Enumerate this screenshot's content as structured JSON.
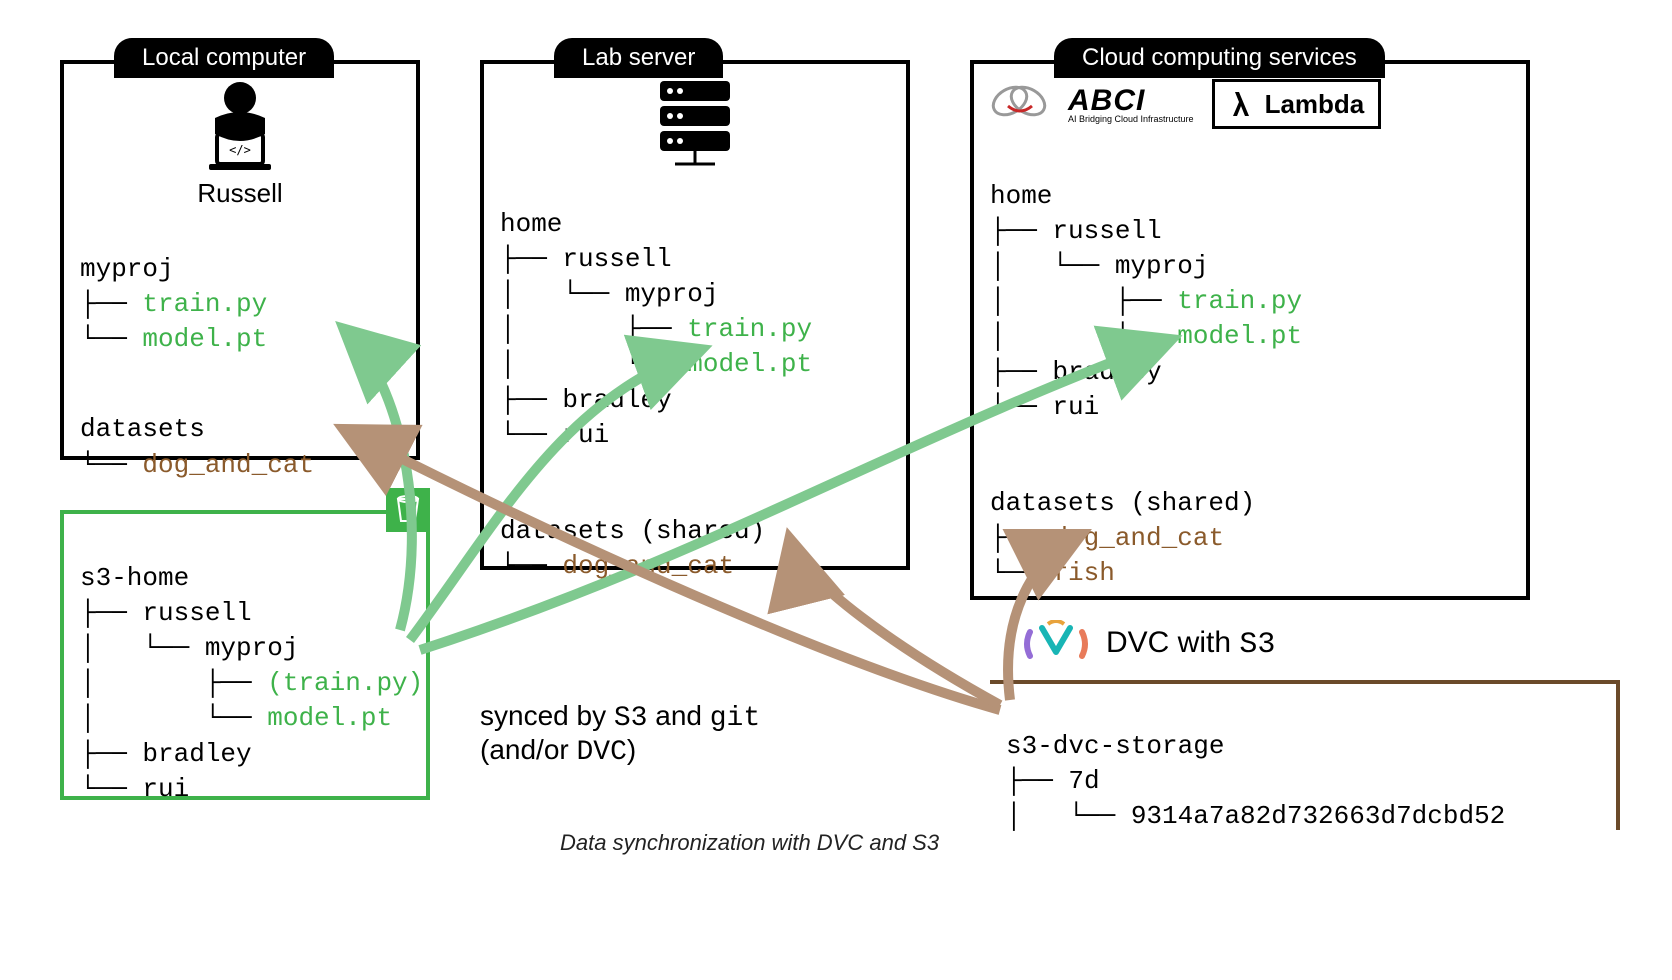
{
  "caption": "Data synchronization with DVC and S3",
  "synced_line1_prefix": "synced by ",
  "synced_s3": "S3",
  "synced_and": " and ",
  "synced_git": "git",
  "synced_line2_prefix": "(and/or ",
  "synced_dvc": "DVC",
  "synced_line2_suffix": ")",
  "dvc_label_prefix": "DVC with ",
  "dvc_label_s3": "S3",
  "boxes": {
    "local": {
      "tab": "Local computer",
      "user": "Russell",
      "tree1_root": "myproj",
      "tree1_file1": "train.py",
      "tree1_file2": "model.pt",
      "tree2_root": "datasets",
      "tree2_file1": "dog_and_cat"
    },
    "lab": {
      "tab": "Lab server",
      "tree1_root": "home",
      "tree1_u1": "russell",
      "tree1_proj": "myproj",
      "tree1_file1": "train.py",
      "tree1_file2": "model.pt",
      "tree1_u2": "bradley",
      "tree1_u3": "rui",
      "tree2_root": "datasets (shared)",
      "tree2_file1": "dog_and_cat"
    },
    "cloud": {
      "tab": "Cloud computing services",
      "logo_abci": "ABCI",
      "logo_abci_sub": "AI Bridging Cloud Infrastructure",
      "logo_lambda": "Lambda",
      "tree1_root": "home",
      "tree1_u1": "russell",
      "tree1_proj": "myproj",
      "tree1_file1": "train.py",
      "tree1_file2": "model.pt",
      "tree1_u2": "bradley",
      "tree1_u3": "rui",
      "tree2_root": "datasets (shared)",
      "tree2_file1": "dog_and_cat",
      "tree2_file2": "fish"
    },
    "s3home": {
      "root": "s3-home",
      "u1": "russell",
      "proj": "myproj",
      "file1": "(train.py)",
      "file2": "model.pt",
      "u2": "bradley",
      "u3": "rui"
    },
    "s3dvc": {
      "root": "s3-dvc-storage",
      "dir": "7d",
      "hash": "9314a7a82d732663d7dcbd52"
    }
  }
}
